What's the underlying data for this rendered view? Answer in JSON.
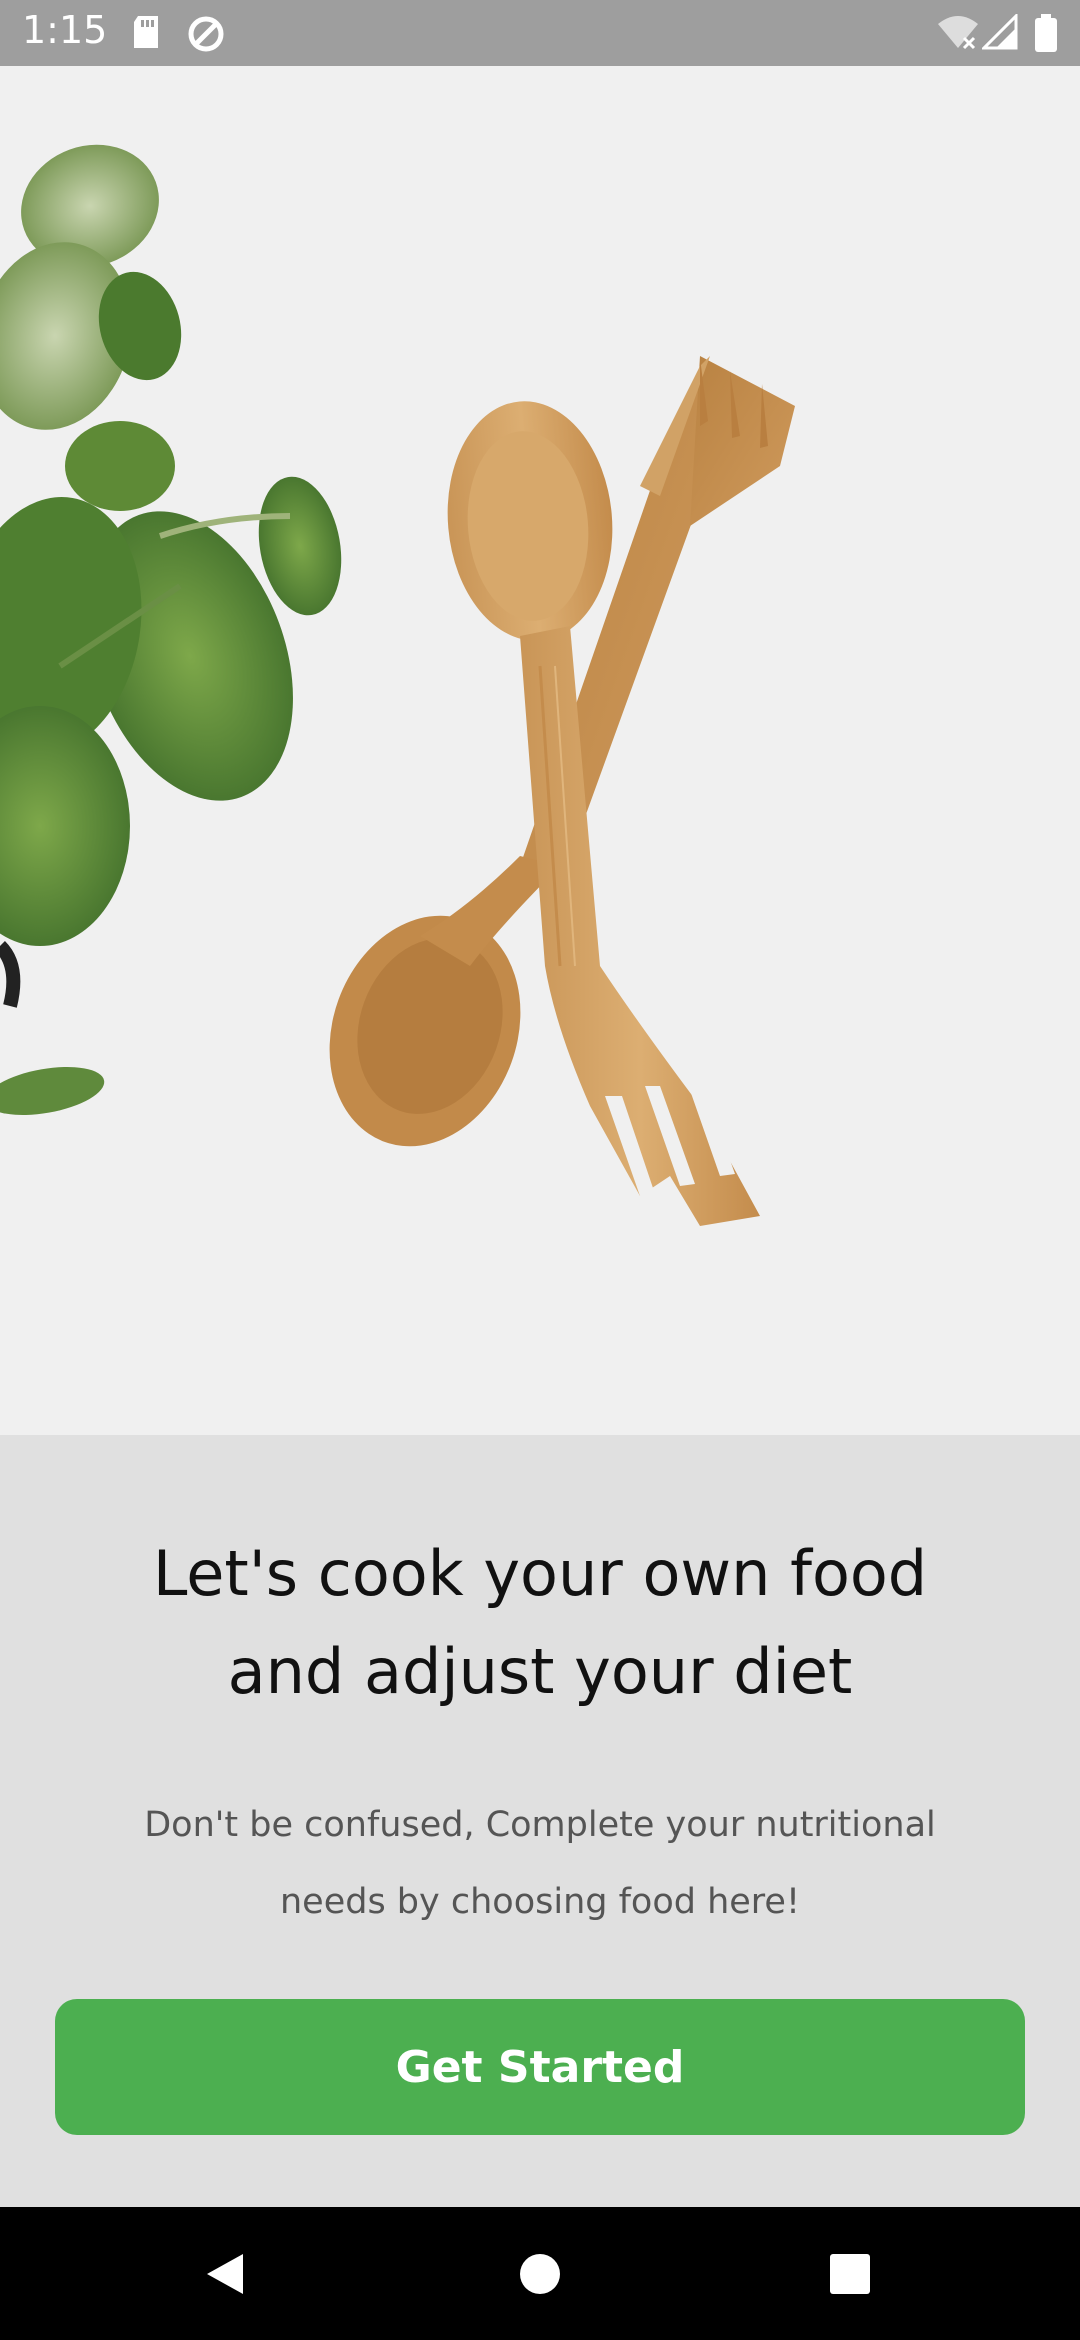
{
  "status_bar": {
    "time": "1:15",
    "icons": [
      "sd-card-icon",
      "sync-icon",
      "wifi-off-icon",
      "signal-icon",
      "battery-icon"
    ]
  },
  "hero": {
    "image": "wooden-spoon-and-fork-with-plant"
  },
  "onboarding": {
    "headline_line1": "Let's cook your own food",
    "headline_line2": "and adjust your diet",
    "subtext_line1": "Don't be confused, Complete your nutritional",
    "subtext_line2": "needs by choosing food here!",
    "cta_label": "Get Started"
  },
  "nav_bar": {
    "buttons": [
      "back-icon",
      "home-icon",
      "recents-icon"
    ]
  },
  "colors": {
    "accent": "#4caf50",
    "background": "#e0e0e0",
    "status_bar": "#9e9e9e"
  }
}
